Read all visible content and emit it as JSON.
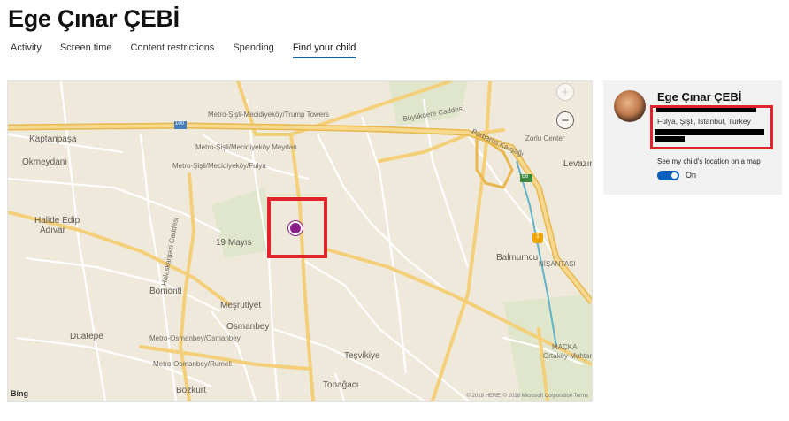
{
  "page": {
    "title": "Ege Çınar ÇEBİ"
  },
  "tabs": [
    {
      "label": "Activity"
    },
    {
      "label": "Screen time"
    },
    {
      "label": "Content restrictions"
    },
    {
      "label": "Spending"
    },
    {
      "label": "Find your child"
    }
  ],
  "active_tab": "Find your child",
  "map": {
    "zoom_in": "+",
    "zoom_out": "−",
    "attribution": "Bing",
    "copyright": "© 2018 HERE, © 2018 Microsoft Corporation  Terms",
    "highway_shields": [
      "100",
      "E6",
      "1"
    ],
    "labels": {
      "kaptanpasa": "Kaptanpaşa",
      "okmeydani": "Okmeydanı",
      "halide": "Halide Edip",
      "adivar": "Adıvar",
      "bomonti": "Bomonti",
      "duatepe": "Duatepe",
      "mesrutiyet": "Meşrutiyet",
      "osmanbey": "Osmanbey",
      "tesvikiye": "Teşvikiye",
      "topagaci": "Topağacı",
      "bozkurt": "Bozkurt",
      "mayis": "19 Mayıs",
      "balmumcu": "Balmumcu",
      "nisantasi": "NİŞANTAŞI",
      "levazim": "Levazım",
      "buyukdere": "Büyükdere Caddesi",
      "barbaros": "Barbaros Kavşağı",
      "metro_trump": "Metro-Şişli-Mecidiyeköy/Trump Towers",
      "metro_meydan": "Metro-Şişli/Mecidiyeköy Meydan",
      "metro_fulya": "Metro-Şişli/Mecidiyeköy/Fulya",
      "metro_osmanbey": "Metro-Osmanbey/Osmanbey",
      "metro_rumeli": "Metro-Osmanbey/Rumeli",
      "halaskargazi": "Halaskargazi Caddesi",
      "maczka": "MAÇKA",
      "ortakoy": "Ortaköy Muhtarlığı",
      "zorlu": "Zorlu Center"
    }
  },
  "child": {
    "name": "Ege Çınar ÇEBİ",
    "location": "Fulya, Şişli, Istanbul, Turkey",
    "toggle_label": "See my child's location on a map",
    "toggle_state": "On",
    "toggle_on": true
  },
  "colors": {
    "accent": "#0067b8",
    "highlight": "#e0242b",
    "pin": "#8d1d8a",
    "map_bg": "#efe9dc",
    "road": "#f4cf7a",
    "toggle": "#0a5ebd"
  }
}
